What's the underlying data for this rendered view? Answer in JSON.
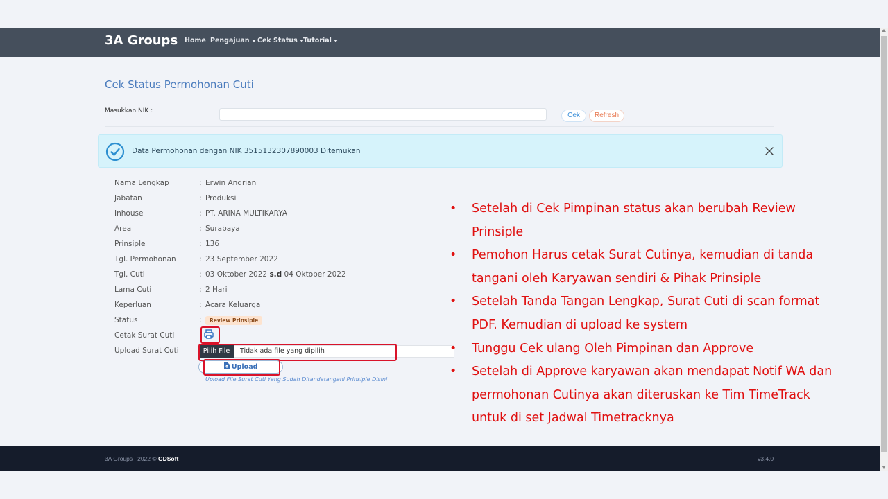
{
  "navbar": {
    "brand": "3A Groups",
    "items": [
      {
        "label": "Home",
        "dropdown": false
      },
      {
        "label": "Pengajuan",
        "dropdown": true
      },
      {
        "label": "Cek Status",
        "dropdown": true
      },
      {
        "label": "Tutorial",
        "dropdown": true
      }
    ]
  },
  "page": {
    "title": "Cek Status Permohonan Cuti",
    "nik_label": "Masukkan NIK :",
    "nik_value": "",
    "cek_label": "Cek",
    "refresh_label": "Refresh"
  },
  "alert": {
    "message": "Data Permohonan dengan NIK 3515132307890003 Ditemukan",
    "icon": "check-circle-icon",
    "close_icon": "close-icon"
  },
  "details": [
    {
      "label": "Nama Lengkap",
      "value": "Erwin Andrian"
    },
    {
      "label": "Jabatan",
      "value": "Produksi"
    },
    {
      "label": "Inhouse",
      "value": "PT. ARINA MULTIKARYA"
    },
    {
      "label": "Area",
      "value": "Surabaya"
    },
    {
      "label": "Prinsiple",
      "value": "136"
    },
    {
      "label": "Tgl. Permohonan",
      "value": "23 September 2022"
    }
  ],
  "cuti": {
    "tgl_label": "Tgl. Cuti",
    "tgl_start": "03 Oktober 2022",
    "tgl_sep": "s.d",
    "tgl_end": "04 Oktober 2022",
    "lama_label": "Lama Cuti",
    "lama_value": "2 Hari",
    "keperluan_label": "Keperluan",
    "keperluan_value": "Acara Keluarga",
    "status_label": "Status",
    "status_value": "Review Prinsiple",
    "cetak_label": "Cetak Surat Cuti",
    "upload_label": "Upload Surat Cuti",
    "file_button": "Pilih File",
    "file_text": "Tidak ada file yang dipilih",
    "upload_button": "Upload",
    "upload_hint": "Upload File Surat Cuti Yang Sudah Ditandatangani Prinsiple Disini"
  },
  "notes": [
    "Setelah di Cek Pimpinan status akan berubah Review Prinsiple",
    "Pemohon Harus cetak Surat Cutinya, kemudian di tanda tangani oleh Karyawan sendiri & Pihak Prinsiple",
    "Setelah Tanda Tangan Lengkap, Surat Cuti di scan format PDF. Kemudian di upload ke system",
    "Tunggu Cek ulang Oleh Pimpinan dan Approve",
    "Setelah di Approve karyawan akan mendapat Notif WA dan permohonan Cutinya akan diteruskan ke Tim TimeTrack untuk di set Jadwal Timetracknya"
  ],
  "footer": {
    "copyright": "3A Groups | 2022 ©",
    "company": "GDSoft",
    "version": "v3.4.0"
  },
  "colors": {
    "navbar": "#454f5c",
    "footer": "#151c2b",
    "annotation": "#e01010",
    "alert_bg": "#d6f3fb"
  }
}
